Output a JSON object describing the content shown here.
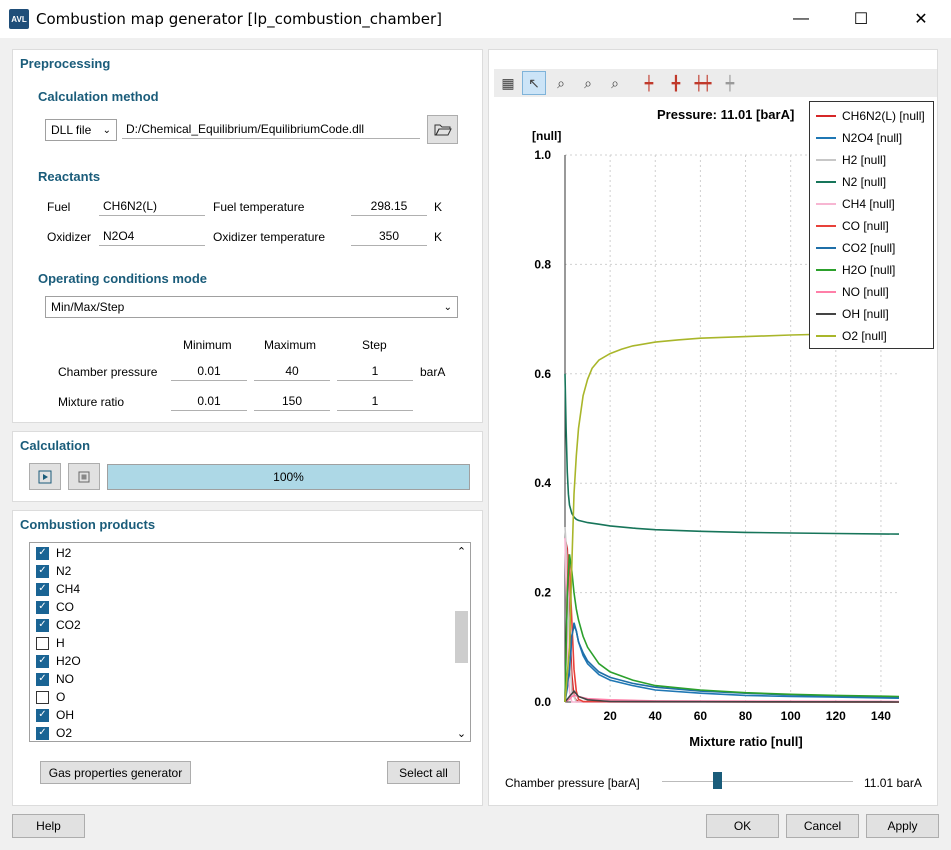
{
  "window": {
    "title": "Combustion map generator [lp_combustion_chamber]",
    "logo": "AVL",
    "minimize": "—",
    "maximize": "☐",
    "close": "✕"
  },
  "preprocessing": {
    "title": "Preprocessing",
    "calc_method_title": "Calculation method",
    "method_select": "DLL file",
    "dll_path": "D:/Chemical_Equilibrium/EquilibriumCode.dll",
    "reactants_title": "Reactants",
    "fuel_label": "Fuel",
    "fuel_value": "CH6N2(L)",
    "fuel_temp_label": "Fuel temperature",
    "fuel_temp_value": "298.15",
    "fuel_temp_unit": "K",
    "oxidizer_label": "Oxidizer",
    "oxidizer_value": "N2O4",
    "oxidizer_temp_label": "Oxidizer temperature",
    "oxidizer_temp_value": "350",
    "oxidizer_temp_unit": "K",
    "op_mode_title": "Operating conditions mode",
    "op_mode_value": "Min/Max/Step",
    "col_min": "Minimum",
    "col_max": "Maximum",
    "col_step": "Step",
    "chamber_pressure_label": "Chamber pressure",
    "cp_min": "0.01",
    "cp_max": "40",
    "cp_step": "1",
    "cp_unit": "barA",
    "mixture_ratio_label": "Mixture ratio",
    "mr_min": "0.01",
    "mr_max": "150",
    "mr_step": "1"
  },
  "calculation": {
    "title": "Calculation",
    "progress_text": "100%",
    "progress": 1.0
  },
  "products": {
    "title": "Combustion products",
    "items": [
      {
        "name": "H2",
        "checked": true
      },
      {
        "name": "N2",
        "checked": true
      },
      {
        "name": "CH4",
        "checked": true
      },
      {
        "name": "CO",
        "checked": true
      },
      {
        "name": "CO2",
        "checked": true
      },
      {
        "name": "H",
        "checked": false
      },
      {
        "name": "H2O",
        "checked": true
      },
      {
        "name": "NO",
        "checked": true
      },
      {
        "name": "O",
        "checked": false
      },
      {
        "name": "OH",
        "checked": true
      },
      {
        "name": "O2",
        "checked": true
      }
    ],
    "gas_props_button": "Gas properties generator",
    "select_all_button": "Select all"
  },
  "chart_data": {
    "type": "line",
    "title": "Pressure: 11.01 [barA]",
    "xlabel": "Mixture ratio [null]",
    "ylabel": "[null]",
    "xlim": [
      0,
      148
    ],
    "ylim": [
      0,
      1.0
    ],
    "xticks": [
      20,
      40,
      60,
      80,
      100,
      120,
      140
    ],
    "yticks": [
      0.0,
      0.2,
      0.4,
      0.6,
      0.8,
      1.0
    ],
    "ytick_labels": [
      "0.0",
      "0.2",
      "0.4",
      "0.6",
      "0.8",
      "1.0"
    ],
    "grid": true,
    "legend_position": "top-right",
    "series": [
      {
        "name": "CH6N2(L) [null]",
        "color": "#d62728",
        "x": [
          0.01,
          1,
          2,
          3,
          4,
          5,
          6,
          8,
          10,
          148
        ],
        "y": [
          0.3,
          0.28,
          0.15,
          0.05,
          0.01,
          0.003,
          0.001,
          0.0,
          0.0,
          0.0
        ]
      },
      {
        "name": "N2O4 [null]",
        "color": "#1f77b4",
        "x": [
          0.01,
          2,
          3,
          4,
          5,
          6,
          8,
          10,
          15,
          20,
          30,
          40,
          60,
          80,
          100,
          120,
          148
        ],
        "y": [
          0.0,
          0.05,
          0.12,
          0.145,
          0.13,
          0.11,
          0.085,
          0.07,
          0.05,
          0.04,
          0.03,
          0.022,
          0.016,
          0.012,
          0.01,
          0.009,
          0.007
        ]
      },
      {
        "name": "H2 [null]",
        "color": "#c7c7c7",
        "x": [
          0.01,
          1,
          2,
          3,
          5,
          148
        ],
        "y": [
          0.32,
          0.25,
          0.1,
          0.02,
          0.0,
          0.0
        ]
      },
      {
        "name": "N2 [null]",
        "color": "#17755a",
        "x": [
          0.01,
          0.5,
          1,
          1.5,
          2,
          3,
          4,
          5,
          6,
          8,
          10,
          15,
          20,
          30,
          40,
          60,
          80,
          100,
          120,
          148
        ],
        "y": [
          0.6,
          0.5,
          0.42,
          0.38,
          0.36,
          0.345,
          0.338,
          0.334,
          0.332,
          0.33,
          0.328,
          0.325,
          0.322,
          0.318,
          0.315,
          0.312,
          0.31,
          0.309,
          0.308,
          0.307
        ]
      },
      {
        "name": "CH4 [null]",
        "color": "#f7b6d2",
        "x": [
          0.01,
          1,
          2,
          3,
          148
        ],
        "y": [
          0.3,
          0.1,
          0.02,
          0.0,
          0.0
        ]
      },
      {
        "name": "CO [null]",
        "color": "#e8413a",
        "x": [
          0.01,
          1,
          1.5,
          2,
          3,
          4,
          5,
          6,
          8,
          148
        ],
        "y": [
          0.0,
          0.2,
          0.27,
          0.25,
          0.15,
          0.06,
          0.02,
          0.005,
          0.001,
          0.0
        ]
      },
      {
        "name": "CO2 [null]",
        "color": "#1f6fa8",
        "x": [
          0.01,
          2,
          3,
          4,
          5,
          6,
          8,
          10,
          15,
          20,
          30,
          40,
          60,
          80,
          100,
          120,
          148
        ],
        "y": [
          0.0,
          0.06,
          0.12,
          0.14,
          0.13,
          0.11,
          0.09,
          0.075,
          0.055,
          0.045,
          0.034,
          0.027,
          0.02,
          0.016,
          0.013,
          0.011,
          0.009
        ]
      },
      {
        "name": "H2O [null]",
        "color": "#2ca02c",
        "x": [
          0.01,
          1,
          2,
          3,
          4,
          5,
          6,
          8,
          10,
          15,
          20,
          30,
          40,
          60,
          80,
          100,
          120,
          148
        ],
        "y": [
          0.0,
          0.2,
          0.27,
          0.24,
          0.2,
          0.17,
          0.15,
          0.12,
          0.1,
          0.07,
          0.055,
          0.04,
          0.03,
          0.022,
          0.017,
          0.014,
          0.012,
          0.01
        ]
      },
      {
        "name": "NO [null]",
        "color": "#ff7fa8",
        "x": [
          0.01,
          2,
          3,
          4,
          6,
          8,
          10,
          20,
          40,
          148
        ],
        "y": [
          0.0,
          0.005,
          0.01,
          0.012,
          0.01,
          0.008,
          0.006,
          0.004,
          0.002,
          0.001
        ]
      },
      {
        "name": "OH [null]",
        "color": "#444444",
        "x": [
          0.01,
          2,
          4,
          6,
          10,
          20,
          148
        ],
        "y": [
          0.0,
          0.01,
          0.02,
          0.01,
          0.004,
          0.001,
          0.0
        ]
      },
      {
        "name": "O2 [null]",
        "color": "#a9b62a",
        "x": [
          0.01,
          2,
          3,
          4,
          5,
          6,
          8,
          10,
          12,
          15,
          20,
          25,
          30,
          40,
          50,
          60,
          80,
          100,
          120,
          148
        ],
        "y": [
          0.0,
          0.1,
          0.25,
          0.38,
          0.45,
          0.5,
          0.56,
          0.59,
          0.61,
          0.625,
          0.637,
          0.645,
          0.651,
          0.658,
          0.662,
          0.665,
          0.668,
          0.671,
          0.673,
          0.675
        ]
      }
    ]
  },
  "slider": {
    "label": "Chamber pressure [barA]",
    "value_text": "11.01 barA",
    "fraction": 0.29
  },
  "footer": {
    "help": "Help",
    "ok": "OK",
    "cancel": "Cancel",
    "apply": "Apply"
  }
}
